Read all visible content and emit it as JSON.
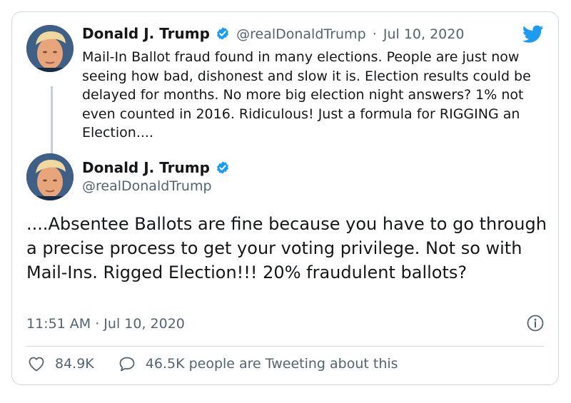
{
  "tweet1": {
    "name": "Donald J. Trump",
    "handle": "@realDonaldTrump",
    "separator": "·",
    "date": "Jul 10, 2020",
    "text": "Mail-In Ballot fraud found in many elections. People are just now seeing how bad, dishonest and slow it is. Election results could be delayed for months. No more big election night answers? 1% not even counted in 2016. Ridiculous! Just a formula for RIGGING an Election...."
  },
  "tweet2": {
    "name": "Donald J. Trump",
    "handle": "@realDonaldTrump",
    "text": "....Absentee Ballots are fine because you have to go through a precise process to get your voting privilege. Not so with Mail-Ins. Rigged Election!!! 20% fraudulent ballots?",
    "timestamp": "11:51 AM · Jul 10, 2020"
  },
  "stats": {
    "likes": "84.9K",
    "tweeting": "46.5K people are Tweeting about this"
  },
  "icons": [
    "verified-badge-icon",
    "twitter-bird-icon",
    "info-icon",
    "heart-icon",
    "speech-bubble-icon"
  ],
  "colors": {
    "twitter_blue": "#1d9bf0",
    "secondary_text": "#536471",
    "border": "#cfd9de"
  }
}
